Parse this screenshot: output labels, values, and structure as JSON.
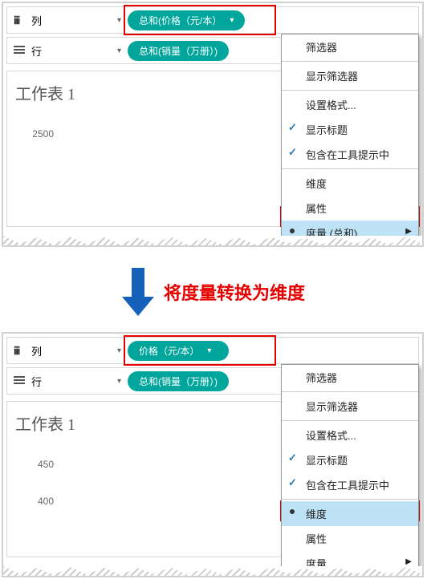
{
  "top": {
    "colShelf": {
      "label": "列",
      "pill": "总和(价格（元/本）"
    },
    "rowShelf": {
      "label": "行",
      "pill": "总和(销量（万册）)"
    },
    "sheetTitle": "工作表 1",
    "axisTicks": [
      "2500"
    ],
    "menu": {
      "filter": "筛选器",
      "showFilter": "显示筛选器",
      "format": "设置格式...",
      "showTitle": "显示标题",
      "includeTooltip": "包含在工具提示中",
      "dimension": "维度",
      "attribute": "属性",
      "measure": "度量 (总和)"
    }
  },
  "annotation": "将度量转换为维度",
  "bottom": {
    "colShelf": {
      "label": "列",
      "pill": "价格（元/本）"
    },
    "rowShelf": {
      "label": "行",
      "pill": "总和(销量（万册）)"
    },
    "sheetTitle": "工作表 1",
    "axisTicks": [
      "450",
      "400"
    ],
    "menu": {
      "filter": "筛选器",
      "showFilter": "显示筛选器",
      "format": "设置格式...",
      "showTitle": "显示标题",
      "includeTooltip": "包含在工具提示中",
      "dimension": "维度",
      "attribute": "属性",
      "measure": "度量"
    }
  }
}
